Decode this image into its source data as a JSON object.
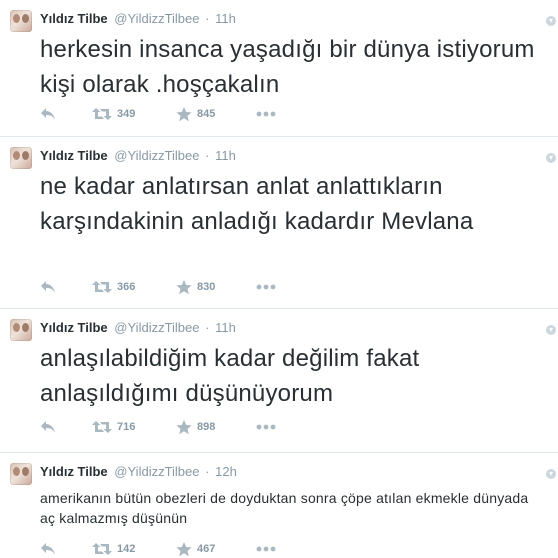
{
  "colors": {
    "name": "#292f33",
    "meta": "#8899a6",
    "icon": "#aab8c2",
    "divider": "#e1e8ed"
  },
  "tweets": [
    {
      "name": "Yıldız Tilbe",
      "handle": "@YildizzTilbee",
      "separator": "·",
      "time": "11h",
      "text": "herkesin insanca yaşadığı bir dünya istiyorum kişi olarak .hoşçakalın",
      "retweets": "349",
      "favorites": "845"
    },
    {
      "name": "Yıldız Tilbe",
      "handle": "@YildizzTilbee",
      "separator": "·",
      "time": "11h",
      "text": "ne kadar anlatırsan anlat anlattıkların karşındakinin anladığı kadardır Mevlana",
      "retweets": "366",
      "favorites": "830"
    },
    {
      "name": "Yıldız Tilbe",
      "handle": "@YildizzTilbee",
      "separator": "·",
      "time": "11h",
      "text": "anlaşılabildiğim kadar değilim fakat anlaşıldığımı düşünüyorum",
      "retweets": "716",
      "favorites": "898"
    },
    {
      "name": "Yıldız Tilbe",
      "handle": "@YildizzTilbee",
      "separator": "·",
      "time": "12h",
      "text": "amerikanın bütün obezleri de doyduktan sonra çöpe atılan ekmekle dünyada aç kalmazmış düşünün",
      "retweets": "142",
      "favorites": "467"
    }
  ],
  "icons": {
    "reply": "reply-icon",
    "retweet": "retweet-icon",
    "favorite": "star-icon",
    "more": "more-dots-icon",
    "caret": "caret-down-icon"
  }
}
